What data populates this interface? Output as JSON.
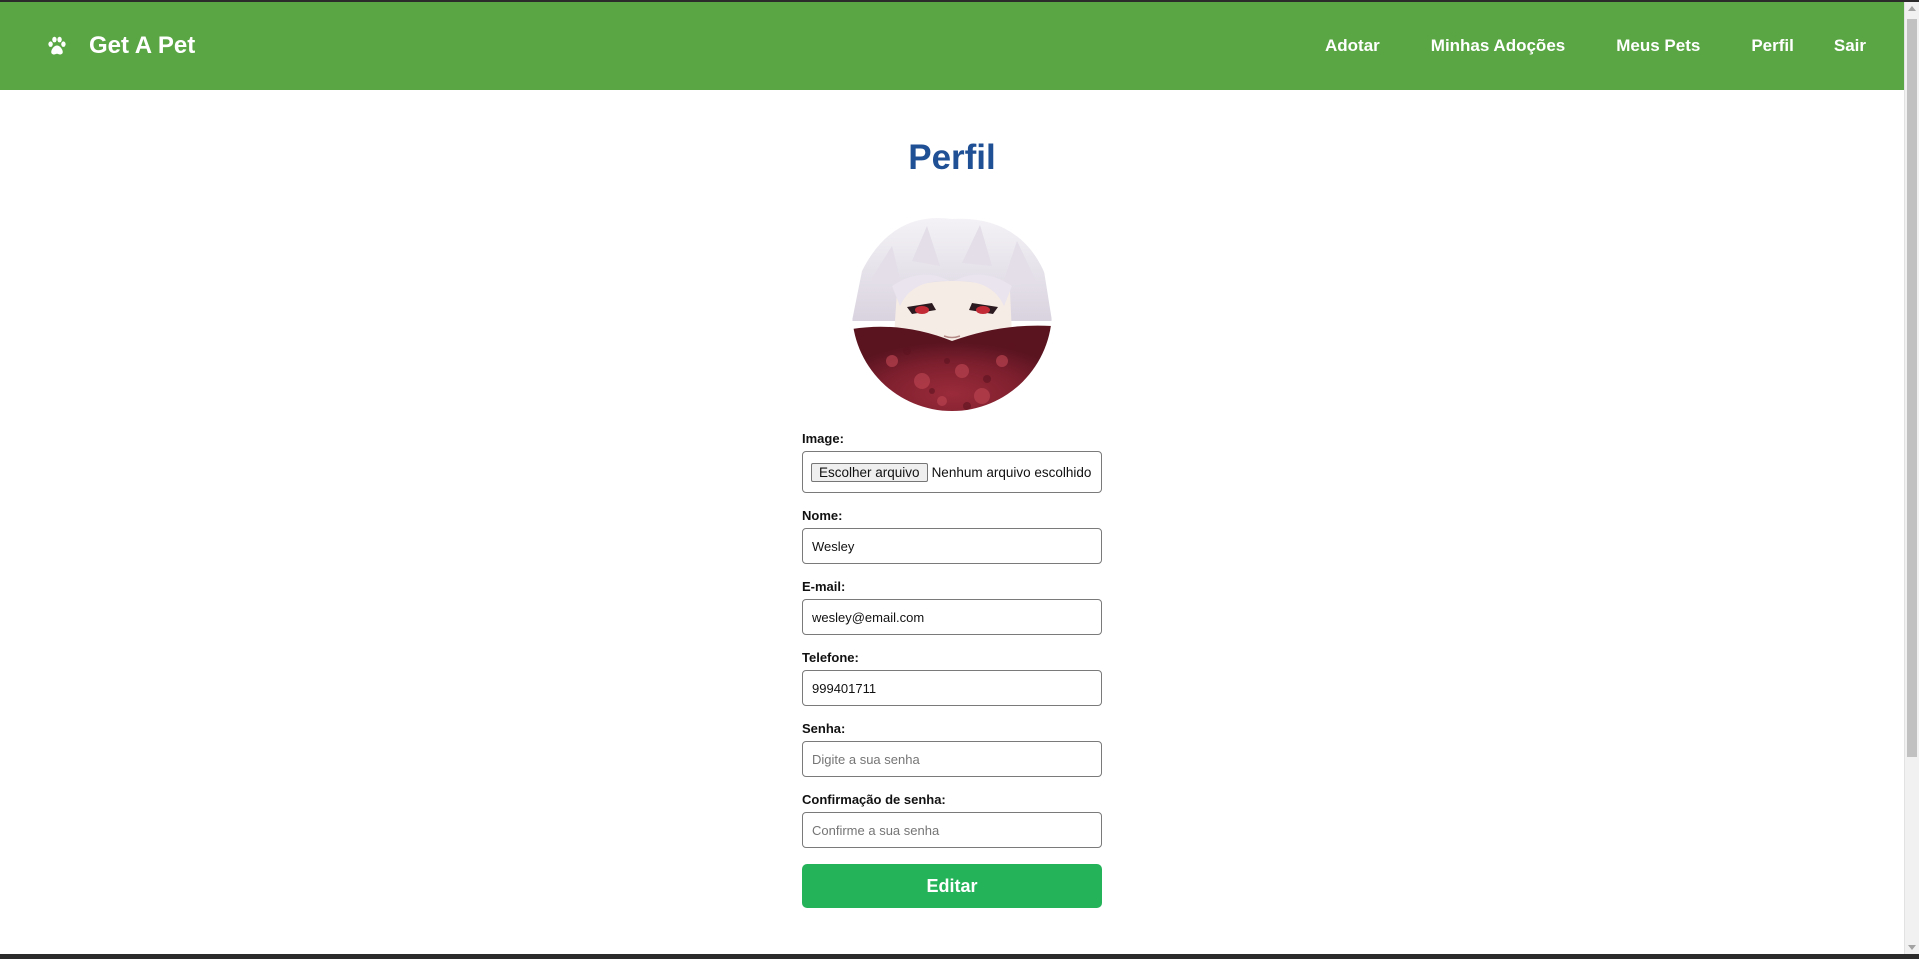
{
  "navbar": {
    "brand": "Get A Pet",
    "links": [
      "Adotar",
      "Minhas Adoções",
      "Meus Pets",
      "Perfil",
      "Sair"
    ]
  },
  "profile": {
    "title": "Perfil",
    "image_label": "Image:",
    "file_button": "Escolher arquivo",
    "file_status": "Nenhum arquivo escolhido",
    "name_label": "Nome:",
    "name_value": "Wesley",
    "email_label": "E-mail:",
    "email_value": "wesley@email.com",
    "phone_label": "Telefone:",
    "phone_value": "999401711",
    "password_label": "Senha:",
    "password_placeholder": "Digite a sua senha",
    "confirm_label": "Confirmação de senha:",
    "confirm_placeholder": "Confirme a sua senha",
    "submit_label": "Editar"
  },
  "colors": {
    "navbar": "#5aa644",
    "title": "#1f4f94",
    "submit": "#25b35a"
  },
  "icons": {
    "brand": "paw-icon"
  }
}
